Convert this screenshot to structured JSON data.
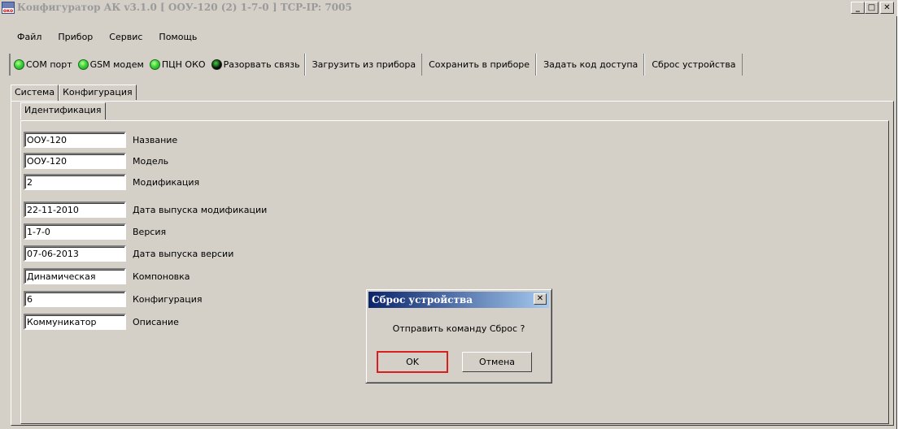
{
  "window": {
    "title": "Конфигуратор АК v3.1.0 [ ООУ-120 (2) 1-7-0 ] TCP-IP: 7005",
    "app_icon_text": "око",
    "minimize": "_",
    "maximize": "□",
    "close": "✕"
  },
  "menu": [
    "Файл",
    "Прибор",
    "Сервис",
    "Помощь"
  ],
  "toolbar": {
    "com_port": "COM порт",
    "gsm_modem": "GSM модем",
    "pcn_oko": "ПЦН ОКО",
    "disconnect": "Разорвать связь",
    "load_from_device": "Загрузить из прибора",
    "save_to_device": "Сохранить в приборе",
    "set_access_code": "Задать код доступа",
    "reset_device": "Сброс устройства"
  },
  "tabs": {
    "system": "Система",
    "configuration": "Конфигурация"
  },
  "subtabs": {
    "identification": "Идентификация"
  },
  "fields": [
    {
      "value": "ООУ-120",
      "label": "Название"
    },
    {
      "value": "ООУ-120",
      "label": "Модель"
    },
    {
      "value": "2",
      "label": "Модификация"
    },
    {
      "value": "22-11-2010",
      "label": "Дата выпуска модификации"
    },
    {
      "value": "1-7-0",
      "label": "Версия"
    },
    {
      "value": "07-06-2013",
      "label": "Дата выпуска версии"
    },
    {
      "value": "Динамическая",
      "label": "Компоновка"
    },
    {
      "value": "6",
      "label": "Конфигурация"
    },
    {
      "value": "Коммуникатор",
      "label": "Описание"
    }
  ],
  "dialog": {
    "title": "Сброс устройства",
    "close": "✕",
    "message": "Отправить команду Сброс ?",
    "ok": "OK",
    "cancel": "Отмена"
  },
  "colors": {
    "led_on": "#3cd43c",
    "dialog_title_start": "#0a246a",
    "ok_focus": "#d81e1e"
  }
}
